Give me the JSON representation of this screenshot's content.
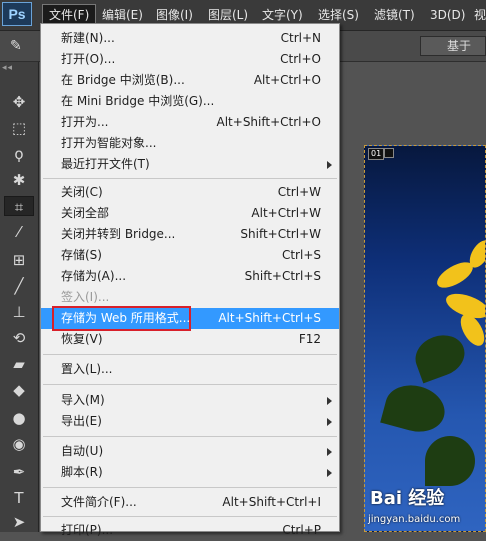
{
  "app": {
    "logo": "Ps"
  },
  "menubar": {
    "items": [
      {
        "label": "文件(F)",
        "active": true
      },
      {
        "label": "编辑(E)"
      },
      {
        "label": "图像(I)"
      },
      {
        "label": "图层(L)"
      },
      {
        "label": "文字(Y)"
      },
      {
        "label": "选择(S)"
      },
      {
        "label": "滤镜(T)"
      },
      {
        "label": "3D(D)"
      },
      {
        "label": "视"
      }
    ]
  },
  "options_bar": {
    "button_label": "基于"
  },
  "toolbar": {
    "grip": "◂◂",
    "tools": [
      {
        "name": "move-tool-icon",
        "glyph": "✥"
      },
      {
        "name": "marquee-tool-icon",
        "glyph": "⬚"
      },
      {
        "name": "lasso-tool-icon",
        "glyph": "ϙ"
      },
      {
        "name": "magic-wand-tool-icon",
        "glyph": "✱"
      },
      {
        "name": "crop-tool-icon",
        "glyph": "⌗"
      },
      {
        "name": "eyedropper-tool-icon",
        "glyph": "⁄"
      },
      {
        "name": "healing-brush-tool-icon",
        "glyph": "⊞"
      },
      {
        "name": "brush-tool-icon",
        "glyph": "╱"
      },
      {
        "name": "clone-stamp-tool-icon",
        "glyph": "⊥"
      },
      {
        "name": "history-brush-tool-icon",
        "glyph": "⟲"
      },
      {
        "name": "eraser-tool-icon",
        "glyph": "▰"
      },
      {
        "name": "paint-bucket-tool-icon",
        "glyph": "◆"
      },
      {
        "name": "blur-tool-icon",
        "glyph": "●"
      },
      {
        "name": "dodge-tool-icon",
        "glyph": "◉"
      },
      {
        "name": "pen-tool-icon",
        "glyph": "✒"
      },
      {
        "name": "type-tool-icon",
        "glyph": "T"
      },
      {
        "name": "path-selection-tool-icon",
        "glyph": "➤"
      }
    ]
  },
  "document": {
    "tab_label": "01"
  },
  "file_menu": {
    "items": [
      {
        "label": "新建(N)...",
        "shortcut": "Ctrl+N"
      },
      {
        "label": "打开(O)...",
        "shortcut": "Ctrl+O"
      },
      {
        "label": "在 Bridge 中浏览(B)...",
        "shortcut": "Alt+Ctrl+O"
      },
      {
        "label": "在 Mini Bridge 中浏览(G)...",
        "shortcut": ""
      },
      {
        "label": "打开为...",
        "shortcut": "Alt+Shift+Ctrl+O"
      },
      {
        "label": "打开为智能对象...",
        "shortcut": ""
      },
      {
        "label": "最近打开文件(T)",
        "shortcut": "",
        "submenu": true
      },
      {
        "label": "关闭(C)",
        "shortcut": "Ctrl+W"
      },
      {
        "label": "关闭全部",
        "shortcut": "Alt+Ctrl+W"
      },
      {
        "label": "关闭并转到 Bridge...",
        "shortcut": "Shift+Ctrl+W"
      },
      {
        "label": "存储(S)",
        "shortcut": "Ctrl+S"
      },
      {
        "label": "存储为(A)...",
        "shortcut": "Shift+Ctrl+S"
      },
      {
        "label": "签入(I)...",
        "shortcut": "",
        "disabled": true
      },
      {
        "label": "存储为 Web 所用格式...",
        "shortcut": "Alt+Shift+Ctrl+S",
        "highlighted": true
      },
      {
        "label": "恢复(V)",
        "shortcut": "F12"
      },
      {
        "label": "置入(L)...",
        "shortcut": ""
      },
      {
        "label": "导入(M)",
        "shortcut": "",
        "submenu": true
      },
      {
        "label": "导出(E)",
        "shortcut": "",
        "submenu": true
      },
      {
        "label": "自动(U)",
        "shortcut": "",
        "submenu": true
      },
      {
        "label": "脚本(R)",
        "shortcut": "",
        "submenu": true
      },
      {
        "label": "文件简介(F)...",
        "shortcut": "Alt+Shift+Ctrl+I"
      },
      {
        "label": "打印(P)...",
        "shortcut": "Ctrl+P"
      }
    ]
  },
  "watermark": {
    "main": "Bai 经验",
    "sub": "jingyan.baidu.com"
  },
  "colors": {
    "highlight": "#3399ff",
    "annotation_box": "#d8202a"
  }
}
